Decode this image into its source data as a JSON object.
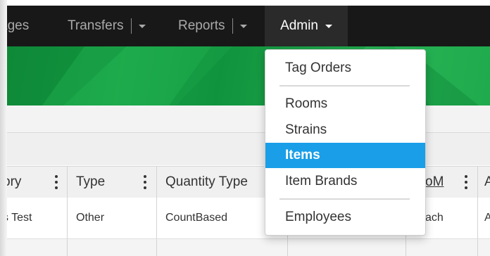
{
  "navbar": {
    "items": [
      {
        "label": "ages",
        "has_caret": false
      },
      {
        "label": "Transfers",
        "has_caret": true
      },
      {
        "label": "Reports",
        "has_caret": true
      }
    ],
    "active_item": {
      "label": "Admin"
    }
  },
  "admin_menu": {
    "items": [
      {
        "label": "Tag Orders",
        "active": false
      },
      {
        "label": "Rooms",
        "active": false
      },
      {
        "label": "Strains",
        "active": false
      },
      {
        "label": "Items",
        "active": true
      },
      {
        "label": "Item Brands",
        "active": false
      },
      {
        "label": "Employees",
        "active": false
      }
    ],
    "active_color": "#1a9ee8"
  },
  "table": {
    "columns": [
      {
        "label": "ory"
      },
      {
        "label": "Type"
      },
      {
        "label": "Quantity Type"
      },
      {
        "label": ""
      },
      {
        "label": "oM"
      },
      {
        "label": "A"
      }
    ],
    "rows": [
      [
        "s Test",
        "Other",
        "CountBased",
        "",
        "ach",
        "A"
      ]
    ]
  },
  "colors": {
    "navbar_bg": "#181818",
    "banner_green": "#1aa84a",
    "selection_blue": "#1a9ee8"
  }
}
